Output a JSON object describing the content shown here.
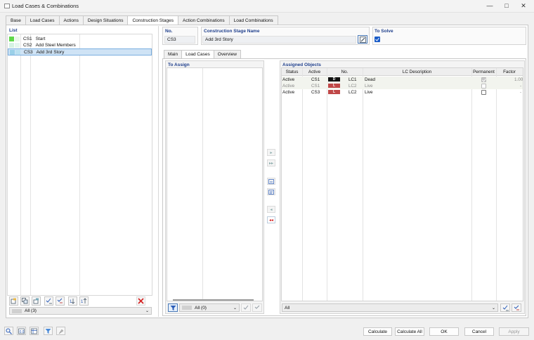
{
  "window": {
    "title": "Load Cases & Combinations"
  },
  "tabs": [
    "Base",
    "Load Cases",
    "Actions",
    "Design Situations",
    "Construction Stages",
    "Action Combinations",
    "Load Combinations"
  ],
  "list": {
    "label": "List",
    "items": [
      {
        "id": "CS1",
        "name": "Start",
        "color": "#5fd84a"
      },
      {
        "id": "CS2",
        "name": "Add Steel Members",
        "color": "#cfeedd"
      },
      {
        "id": "CS3",
        "name": "Add 3rd Story",
        "color": "#9ad0e8"
      }
    ],
    "filter": "All (3)"
  },
  "no": {
    "label": "No.",
    "value": "CS3"
  },
  "stage_name": {
    "label": "Construction Stage Name",
    "value": "Add 3rd Story"
  },
  "to_solve": {
    "label": "To Solve",
    "checked": true
  },
  "subtabs": [
    "Main",
    "Load Cases",
    "Overview"
  ],
  "to_assign": {
    "label": "To Assign",
    "filter": "All (0)"
  },
  "assigned": {
    "label": "Assigned Objects",
    "columns": [
      "Status",
      "Active",
      "No.",
      "LC Description",
      "Permanent",
      "Factor"
    ],
    "rows": [
      {
        "status": "Active",
        "active": "CS1",
        "badge": "D",
        "badge_color": "#111111",
        "no": "LC1",
        "desc": "Dead",
        "permanent": true,
        "factor": "1.00",
        "muted": false
      },
      {
        "status": "Active",
        "active": "CS1",
        "badge": "L",
        "badge_color": "#c04848",
        "no": "LC2",
        "desc": "Live",
        "permanent": false,
        "factor": "-",
        "muted": true
      },
      {
        "status": "Active",
        "active": "CS3",
        "badge": "L",
        "badge_color": "#c04848",
        "no": "LC2",
        "desc": "Live",
        "permanent": false,
        "factor": "-",
        "muted": false
      }
    ],
    "filter": "All"
  },
  "footer": {
    "calculate": "Calculate",
    "calculate_all": "Calculate All",
    "ok": "OK",
    "cancel": "Cancel",
    "apply": "Apply"
  }
}
